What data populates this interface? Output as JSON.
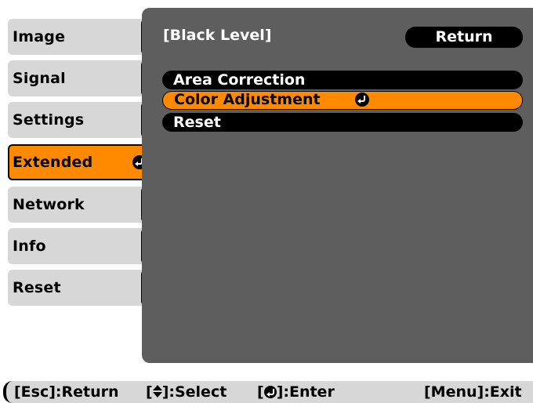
{
  "sidebar": {
    "items": [
      {
        "label": "Image"
      },
      {
        "label": "Signal"
      },
      {
        "label": "Settings"
      },
      {
        "label": "Extended",
        "active": true
      },
      {
        "label": "Network"
      },
      {
        "label": "Info"
      },
      {
        "label": "Reset"
      }
    ]
  },
  "panel": {
    "title": "[Black Level]",
    "return_label": "Return",
    "items": [
      {
        "label": "Area Correction"
      },
      {
        "label": "Color Adjustment",
        "selected": true
      },
      {
        "label": "Reset"
      }
    ]
  },
  "statusbar": {
    "esc_key": "[Esc]",
    "esc_action": ":Return",
    "select_open": "[",
    "select_close": "]:Select",
    "enter_open": "[",
    "enter_close": "]:Enter",
    "menu_hint": "[Menu]:Exit"
  },
  "colors": {
    "accent": "#ff8a00",
    "panel": "#5e5e5e",
    "tab": "#d7d7d7"
  }
}
